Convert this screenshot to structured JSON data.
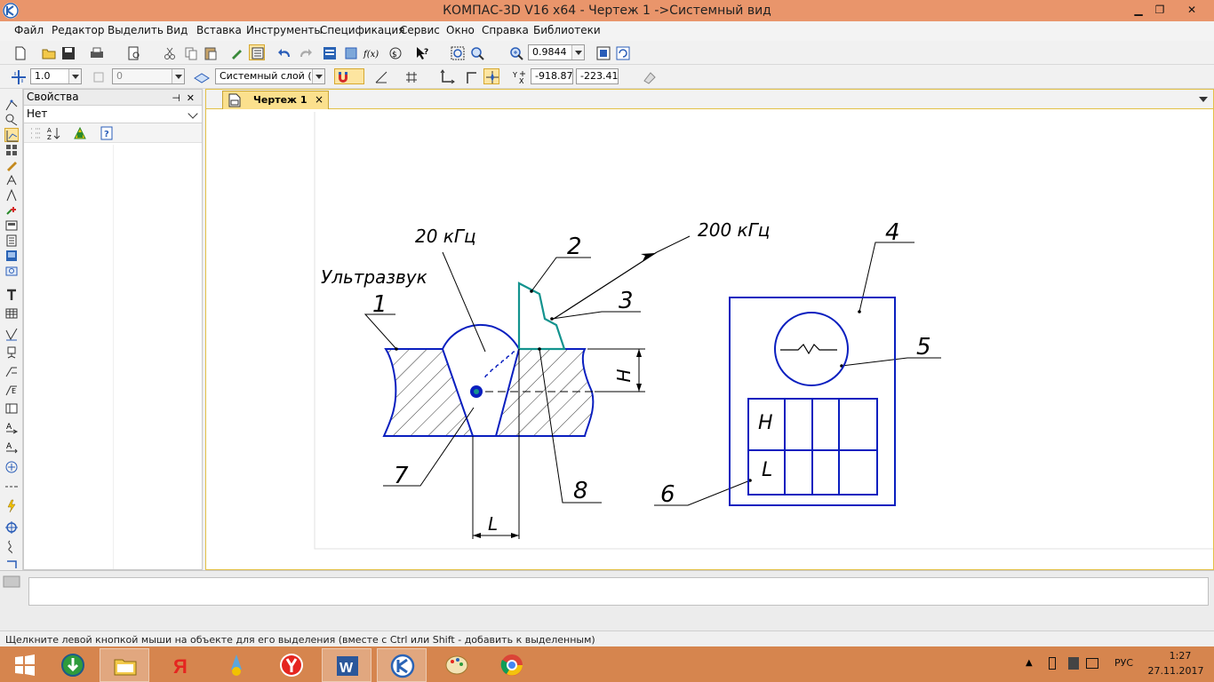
{
  "window": {
    "title": "КОМПАС-3D V16  x64 - Чертеж 1 ->Системный вид"
  },
  "menu": [
    {
      "label": "Файл"
    },
    {
      "label": "Редактор"
    },
    {
      "label": "Выделить"
    },
    {
      "label": "Вид"
    },
    {
      "label": "Вставка"
    },
    {
      "label": "Инструменты"
    },
    {
      "label": "Спецификация"
    },
    {
      "label": "Сервис"
    },
    {
      "label": "Окно"
    },
    {
      "label": "Справка"
    },
    {
      "label": "Библиотеки"
    }
  ],
  "toolbar": {
    "zoom_value": "0.9844",
    "line_scale": "1.0",
    "step_value": "0",
    "layer": "Системный слой (0)",
    "coord_x": "-918.870",
    "coord_y": "-223.418"
  },
  "properties_panel": {
    "title": "Свойства",
    "pin_icon": "pin-icon",
    "close_icon": "close-icon",
    "filter_value": "Нет"
  },
  "document_tab": {
    "label": "Чертеж 1",
    "close": "×"
  },
  "drawing": {
    "label_ultrasound": "Ультразвук",
    "label_freq_low": "20 кГц",
    "label_freq_high": "200 кГц",
    "leader_1": "1",
    "leader_2": "2",
    "leader_3": "3",
    "leader_4": "4",
    "leader_5": "5",
    "leader_6": "6",
    "leader_7": "7",
    "leader_8": "8",
    "dim_h": "H",
    "dim_l": "L",
    "table_h": "H",
    "table_l": "L",
    "colors": {
      "outline": "#0a1fbf",
      "probe": "#13938e",
      "hatch": "#000000"
    }
  },
  "status": {
    "hint": "Щелкните левой кнопкой мыши на объекте для его выделения (вместе с Ctrl или Shift - добавить к выделенным)"
  },
  "taskbar": {
    "apps": [
      "start-icon",
      "kompas-downloader-icon",
      "file-explorer-icon",
      "yandex-icon",
      "paint-net-icon",
      "yandex-browser-icon",
      "word-icon",
      "kompas-icon",
      "paint-icon",
      "chrome-icon"
    ],
    "language": "РУС",
    "time": "1:27",
    "date": "27.11.2017"
  }
}
